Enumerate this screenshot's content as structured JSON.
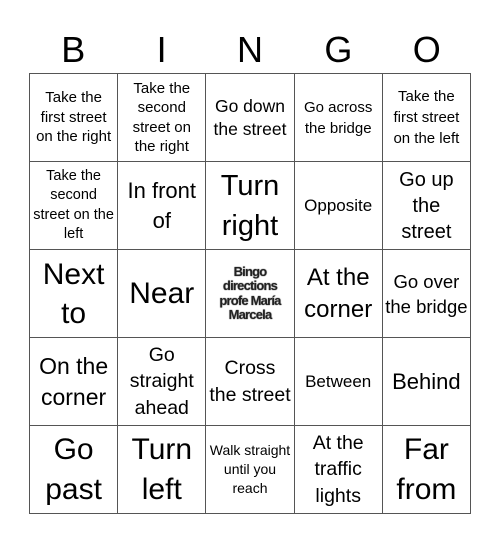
{
  "header": {
    "letters": [
      "B",
      "I",
      "N",
      "G",
      "O"
    ]
  },
  "board": {
    "cells": [
      {
        "text": "Take the first street on the right",
        "size": 15,
        "lh": 19.5
      },
      {
        "text": "Take the second street on the right",
        "size": 15,
        "lh": 19.5
      },
      {
        "text": "Go down the street",
        "size": 17.5,
        "lh": 23
      },
      {
        "text": "Go across the bridge",
        "size": 15,
        "lh": 21
      },
      {
        "text": "Take the first street on the left",
        "size": 15,
        "lh": 21
      },
      {
        "text": "Take the second street on the left",
        "size": 14.5,
        "lh": 19.5
      },
      {
        "text": "In front of",
        "size": 22,
        "lh": 30
      },
      {
        "text": "Turn right",
        "size": 29,
        "lh": 40
      },
      {
        "text": "Opposite",
        "size": 17,
        "lh": 22
      },
      {
        "text": "Go up the street",
        "size": 20,
        "lh": 26
      },
      {
        "text": "Next to",
        "size": 30,
        "lh": 39
      },
      {
        "text": "Near",
        "size": 30,
        "lh": 36
      },
      {
        "text": "Bingo directions profe María Marcela",
        "size": 13,
        "lh": 14.5,
        "free": true
      },
      {
        "text": "At the corner",
        "size": 24,
        "lh": 32
      },
      {
        "text": "Go over the bridge",
        "size": 18.5,
        "lh": 25
      },
      {
        "text": "On the corner",
        "size": 23,
        "lh": 31
      },
      {
        "text": "Go straight ahead",
        "size": 19.5,
        "lh": 26.5
      },
      {
        "text": "Cross the street",
        "size": 19.5,
        "lh": 26.5
      },
      {
        "text": "Between",
        "size": 17,
        "lh": 22
      },
      {
        "text": "Behind",
        "size": 22,
        "lh": 28
      },
      {
        "text": "Go past",
        "size": 30,
        "lh": 40
      },
      {
        "text": "Turn left",
        "size": 30,
        "lh": 40
      },
      {
        "text": "Walk straight until you reach",
        "size": 14,
        "lh": 19
      },
      {
        "text": "At the traffic lights",
        "size": 19.5,
        "lh": 26.5
      },
      {
        "text": "Far from",
        "size": 30,
        "lh": 40
      }
    ]
  }
}
